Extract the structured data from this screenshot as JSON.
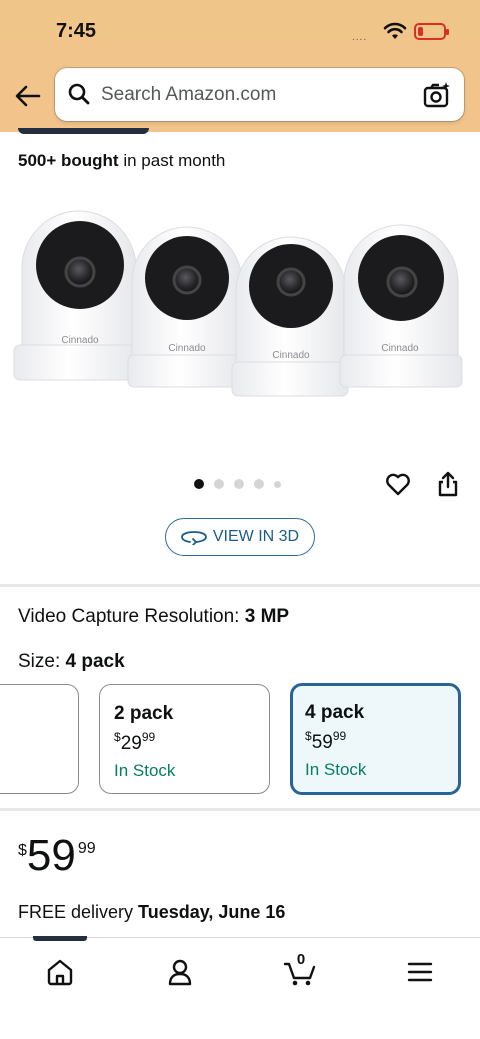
{
  "status_bar": {
    "time": "7:45",
    "signal": "...."
  },
  "search": {
    "placeholder": "Search Amazon.com"
  },
  "social_proof": {
    "count": "500+ bought",
    "suffix": " in past month"
  },
  "product": {
    "brand_label": "Cinnado",
    "gallery_active_index": 0,
    "gallery_count": 5
  },
  "view_3d": {
    "label": "VIEW IN 3D"
  },
  "variations": {
    "resolution_label": "Video Capture Resolution: ",
    "resolution_value": "3 MP",
    "size_label": "Size: ",
    "size_value": "4 pack",
    "options": [
      {
        "name": "2 pack",
        "price_whole": "29",
        "price_fraction": "99",
        "currency": "$",
        "stock": "In Stock",
        "selected": false
      },
      {
        "name": "4 pack",
        "price_whole": "59",
        "price_fraction": "99",
        "currency": "$",
        "stock": "In Stock",
        "selected": true
      }
    ]
  },
  "price": {
    "currency": "$",
    "whole": "59",
    "fraction": "99"
  },
  "delivery": {
    "prefix": "FREE delivery ",
    "date": "Tuesday, June 16"
  },
  "cart": {
    "count": "0"
  },
  "colors": {
    "accent": "#2a6496",
    "stock": "#067d62",
    "header": "#f0c58a"
  }
}
